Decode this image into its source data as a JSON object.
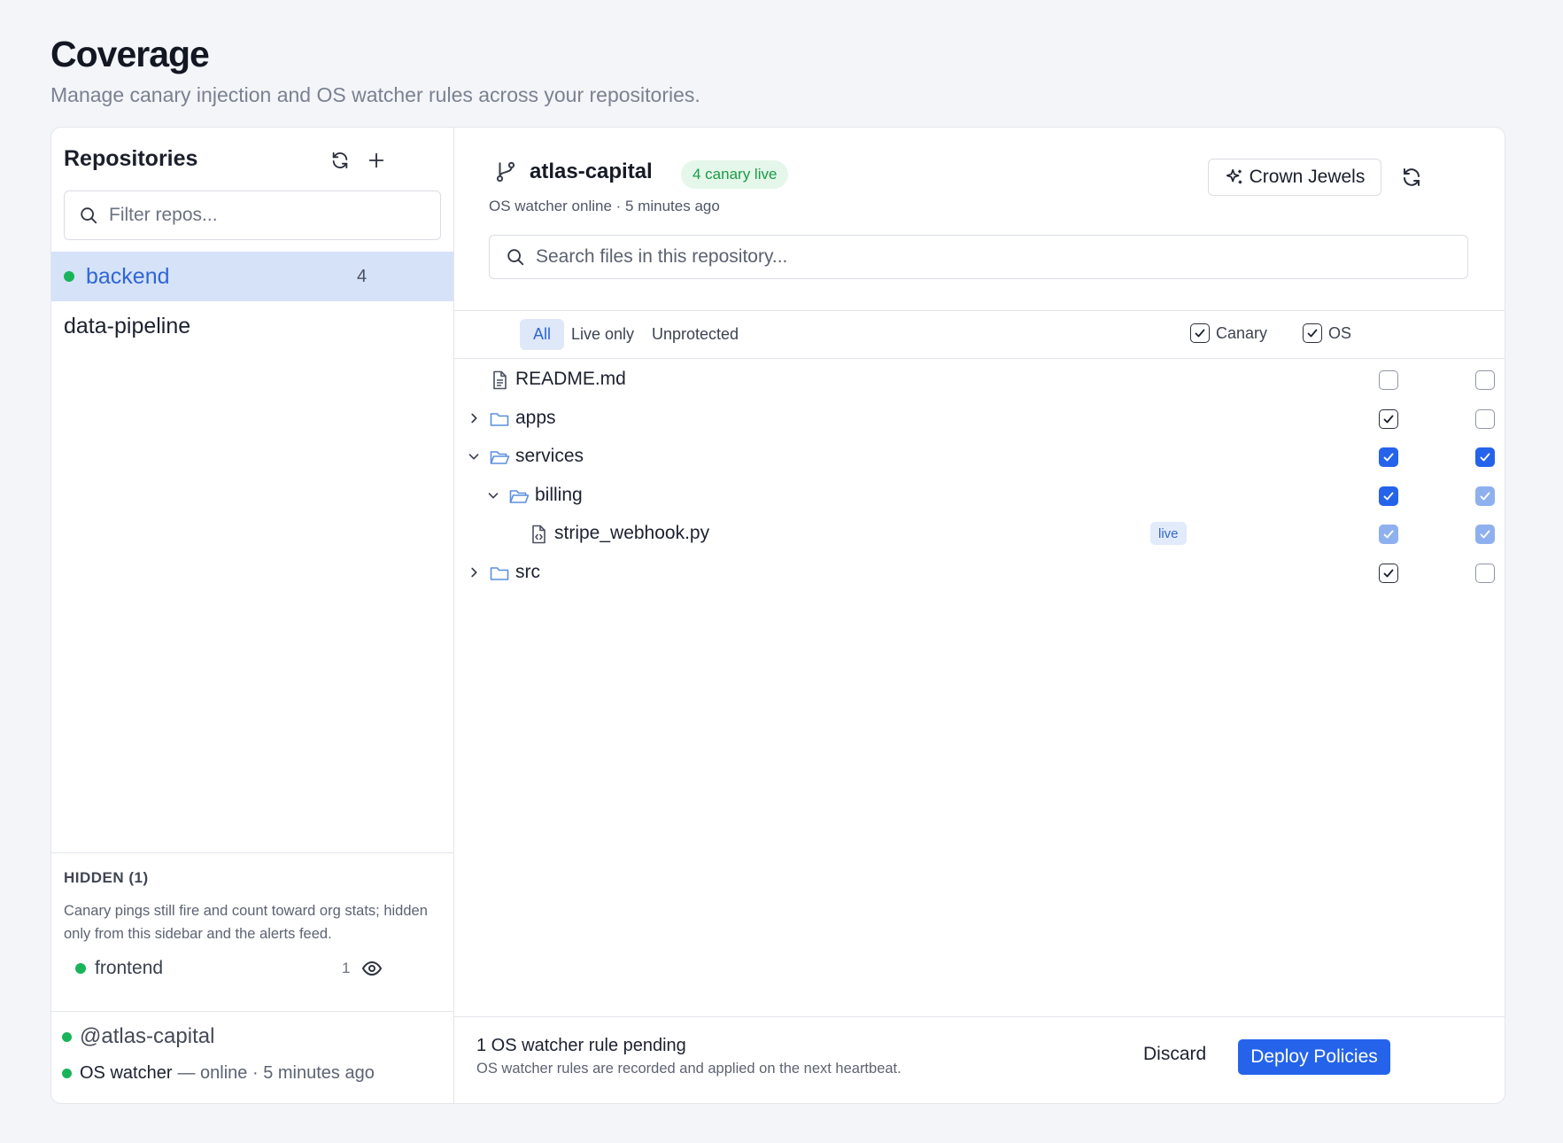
{
  "page": {
    "title": "Coverage",
    "subtitle": "Manage canary injection and OS watcher rules across your repositories."
  },
  "sidebar": {
    "title": "Repositories",
    "filter_placeholder": "Filter repos...",
    "repos": [
      {
        "name": "backend",
        "count": "4",
        "status": "online",
        "selected": true
      },
      {
        "name": "data-pipeline",
        "count": "",
        "status": "",
        "selected": false
      }
    ],
    "hidden": {
      "title": "HIDDEN (1)",
      "description": "Canary pings still fire and count toward org stats; hidden only from this sidebar and the alerts feed.",
      "repos": [
        {
          "name": "frontend",
          "count": "1"
        }
      ]
    },
    "footer": {
      "org": "@atlas-capital",
      "watcher_label": "OS watcher",
      "watcher_status": "— online · 5 minutes ago"
    }
  },
  "main": {
    "repo_name": "atlas-capital",
    "badge": "4 canary live",
    "status": "OS watcher online · 5 minutes ago",
    "crown_jewels_label": "Crown Jewels",
    "search_placeholder": "Search files in this repository...",
    "tabs": [
      "All",
      "Live only",
      "Unprotected"
    ],
    "active_tab": "All",
    "columns": {
      "canary": "Canary",
      "os": "OS"
    },
    "tree": [
      {
        "name": "README.md",
        "type": "file",
        "depth": 0,
        "expanded": null,
        "live": false,
        "canary": "unchecked",
        "os": "unchecked"
      },
      {
        "name": "apps",
        "type": "folder",
        "depth": 0,
        "expanded": false,
        "live": false,
        "canary": "checked",
        "os": "unchecked"
      },
      {
        "name": "services",
        "type": "folder",
        "depth": 0,
        "expanded": true,
        "live": false,
        "canary": "filled",
        "os": "filled"
      },
      {
        "name": "billing",
        "type": "folder",
        "depth": 1,
        "expanded": true,
        "live": false,
        "canary": "filled",
        "os": "inherited"
      },
      {
        "name": "stripe_webhook.py",
        "type": "code-file",
        "depth": 2,
        "expanded": null,
        "live": true,
        "canary": "inherited",
        "os": "inherited"
      },
      {
        "name": "src",
        "type": "folder",
        "depth": 0,
        "expanded": false,
        "live": false,
        "canary": "checked",
        "os": "unchecked"
      }
    ],
    "live_label": "live",
    "footer": {
      "pending_title": "1 OS watcher rule pending",
      "pending_desc": "OS watcher rules are recorded and applied on the next heartbeat.",
      "discard_label": "Discard",
      "deploy_label": "Deploy Policies"
    }
  },
  "colors": {
    "accent": "#2563eb",
    "accent_light": "#8fb0ef",
    "selected_row": "#d6e2f8",
    "online_dot": "#19b45a",
    "badge_bg": "#e4f7ea",
    "badge_text": "#1b9a47"
  }
}
